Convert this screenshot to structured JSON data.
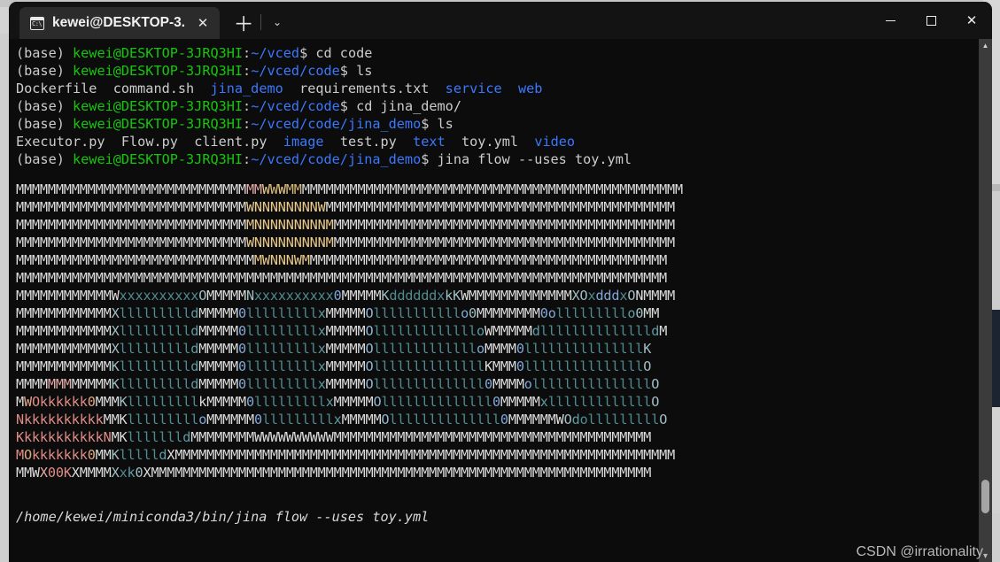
{
  "window": {
    "tab": {
      "icon": "console-icon",
      "title": "kewei@DESKTOP-3.",
      "close_label": "✕"
    },
    "newtab_label": "＋",
    "tabmenu_label": "⌄",
    "controls": {
      "minimize_label": "–",
      "maximize_label": "□",
      "close_label": "✕"
    }
  },
  "colors": {
    "terminal_bg": "#0c0c0c",
    "titlebar_bg": "#131313",
    "tab_bg": "#2b2b2b",
    "prompt_green": "#16c60c",
    "path_blue": "#3b78ff",
    "dir_blue": "#3b78ff",
    "text_white": "#cccccc",
    "scrollbar_track": "#3b3b3b",
    "scrollbar_thumb": "#a6a6a6",
    "art_gold": "#e8c98a",
    "art_teal": "#4e8b92",
    "art_blue": "#7fa8d8",
    "art_salmon": "#e3a9a5"
  },
  "terminal": {
    "lines": [
      {
        "type": "prompt",
        "env": "(base) ",
        "user_host": "kewei@DESKTOP-3JRQ3HI",
        "colon": ":",
        "path": "~/vced",
        "dollar": "$ ",
        "command": "cd code"
      },
      {
        "type": "prompt",
        "env": "(base) ",
        "user_host": "kewei@DESKTOP-3JRQ3HI",
        "colon": ":",
        "path": "~/vced/code",
        "dollar": "$ ",
        "command": "ls"
      },
      {
        "type": "ls",
        "entries": [
          {
            "name": "Dockerfile",
            "kind": "file"
          },
          {
            "name": "command.sh",
            "kind": "file"
          },
          {
            "name": "jina_demo",
            "kind": "dir"
          },
          {
            "name": "requirements.txt",
            "kind": "file"
          },
          {
            "name": "service",
            "kind": "dir"
          },
          {
            "name": "web",
            "kind": "dir"
          }
        ]
      },
      {
        "type": "prompt",
        "env": "(base) ",
        "user_host": "kewei@DESKTOP-3JRQ3HI",
        "colon": ":",
        "path": "~/vced/code",
        "dollar": "$ ",
        "command": "cd jina_demo/"
      },
      {
        "type": "prompt",
        "env": "(base) ",
        "user_host": "kewei@DESKTOP-3JRQ3HI",
        "colon": ":",
        "path": "~/vced/code/jina_demo",
        "dollar": "$ ",
        "command": "ls"
      },
      {
        "type": "ls",
        "entries": [
          {
            "name": "Executor.py",
            "kind": "file"
          },
          {
            "name": "Flow.py",
            "kind": "file"
          },
          {
            "name": "client.py",
            "kind": "file"
          },
          {
            "name": "image",
            "kind": "dir"
          },
          {
            "name": "test.py",
            "kind": "file"
          },
          {
            "name": "text",
            "kind": "dir"
          },
          {
            "name": "toy.yml",
            "kind": "file"
          },
          {
            "name": "video",
            "kind": "dir"
          }
        ]
      },
      {
        "type": "prompt",
        "env": "(base) ",
        "user_host": "kewei@DESKTOP-3JRQ3HI",
        "colon": ":",
        "path": "~/vced/code/jina_demo",
        "dollar": "$ ",
        "command": "jina flow --uses toy.yml"
      }
    ],
    "ascii_art": [
      [
        {
          "t": "MMMMMMMMMMMMMMMMMMMMMMMMMMMMM",
          "c": "a-w"
        },
        {
          "t": "MM",
          "c": "a-pk"
        },
        {
          "t": "W",
          "c": "a-gd"
        },
        {
          "t": "W",
          "c": "a-gd2"
        },
        {
          "t": "W",
          "c": "a-gd"
        },
        {
          "t": "MM",
          "c": "a-gd2"
        },
        {
          "t": "MMMMMMMMMMMMMMMMMMMMMMMMMMMMMMMMMMMMMMMMMMMMMMMM",
          "c": "a-w"
        }
      ],
      [
        {
          "t": "MMMMMMMMMMMMMMMMMMMMMMMMMMMMM",
          "c": "a-w"
        },
        {
          "t": "WNNNNNNNNW",
          "c": "a-gd"
        },
        {
          "t": "MMMMMMMMMMMMMMMMMMMMMMMMMMMMMMMMMMMMMMMMMMMM",
          "c": "a-w"
        }
      ],
      [
        {
          "t": "MMMMMMMMMMMMMMMMMMMMMMMMMMMMM",
          "c": "a-w"
        },
        {
          "t": "MNNNNNNNNNM",
          "c": "a-gd"
        },
        {
          "t": "MMMMMMMMMMMMMMMMMMMMMMMMMMMMMMMMMMMMMMMMMMM",
          "c": "a-w"
        }
      ],
      [
        {
          "t": "MMMMMMMMMMMMMMMMMMMMMMMMMMMMM",
          "c": "a-w"
        },
        {
          "t": "WNNNNNNNNNM",
          "c": "a-gd"
        },
        {
          "t": "MMMMMMMMMMMMMMMMMMMMMMMMMMMMMMMMMMMMMMMMMMM",
          "c": "a-w"
        }
      ],
      [
        {
          "t": "MMMMMMMMMMMMMMMMMMMMMMMMMMMMMM",
          "c": "a-w"
        },
        {
          "t": "MWNNNWM",
          "c": "a-gd"
        },
        {
          "t": "MMMMMMMMMMMMMMMMMMMMMMMMMMMMMMMMMMMMMMMMMMMMM",
          "c": "a-w"
        }
      ],
      [
        {
          "t": "MMMMMMMMMMMMMMMMMMMMMMMMMMMMMMMMMMMMMMMMMMMMMMMMMMMMMMMMMMMMMMMMMMMMMMMMMMMMMMMMMM",
          "c": "a-w"
        }
      ],
      [
        {
          "t": "MMMMMMMMMMMM",
          "c": "a-w"
        },
        {
          "t": "W",
          "c": "a-w"
        },
        {
          "t": "xxxxxxxxxx",
          "c": "a-tl"
        },
        {
          "t": "O",
          "c": "a-dk"
        },
        {
          "t": "MMMMM",
          "c": "a-w"
        },
        {
          "t": "N",
          "c": "a-dk"
        },
        {
          "t": "xxxxxxxxxx",
          "c": "a-tl"
        },
        {
          "t": "0",
          "c": "a-bl"
        },
        {
          "t": "MMMMM",
          "c": "a-w"
        },
        {
          "t": "K",
          "c": "a-dk"
        },
        {
          "t": "dddddd",
          "c": "a-tl"
        },
        {
          "t": "x",
          "c": "a-tl"
        },
        {
          "t": "k",
          "c": "a-dk"
        },
        {
          "t": "K",
          "c": "a-dk"
        },
        {
          "t": "WMMMMMMMMMMMMM",
          "c": "a-w"
        },
        {
          "t": "X",
          "c": "a-dk"
        },
        {
          "t": "O",
          "c": "a-dk"
        },
        {
          "t": "x",
          "c": "a-tl"
        },
        {
          "t": "ddd",
          "c": "a-bl"
        },
        {
          "t": "x",
          "c": "a-tl"
        },
        {
          "t": "O",
          "c": "a-dk"
        },
        {
          "t": "N",
          "c": "a-w"
        },
        {
          "t": "MMMM",
          "c": "a-w"
        }
      ],
      [
        {
          "t": "MMMMMMMMMMMM",
          "c": "a-w"
        },
        {
          "t": "X",
          "c": "a-dk"
        },
        {
          "t": "lllllllll",
          "c": "a-tl"
        },
        {
          "t": "d",
          "c": "a-tl2"
        },
        {
          "t": "MMMMM",
          "c": "a-w"
        },
        {
          "t": "0",
          "c": "a-bl"
        },
        {
          "t": "lllllllll",
          "c": "a-tl"
        },
        {
          "t": "x",
          "c": "a-tl2"
        },
        {
          "t": "MMMMM",
          "c": "a-w"
        },
        {
          "t": "O",
          "c": "a-sl"
        },
        {
          "t": "lllllllllll",
          "c": "a-tl"
        },
        {
          "t": "o",
          "c": "a-bl"
        },
        {
          "t": "0",
          "c": "a-dk"
        },
        {
          "t": "MMMMMMMM",
          "c": "a-w"
        },
        {
          "t": "0",
          "c": "a-bl"
        },
        {
          "t": "o",
          "c": "a-bl"
        },
        {
          "t": "lllllllll",
          "c": "a-tl"
        },
        {
          "t": "o",
          "c": "a-tl2"
        },
        {
          "t": "0",
          "c": "a-dk"
        },
        {
          "t": "MM",
          "c": "a-w"
        }
      ],
      [
        {
          "t": "MMMMMMMMMMMM",
          "c": "a-w"
        },
        {
          "t": "X",
          "c": "a-dk"
        },
        {
          "t": "lllllllll",
          "c": "a-tl"
        },
        {
          "t": "d",
          "c": "a-tl2"
        },
        {
          "t": "MMMMM",
          "c": "a-w"
        },
        {
          "t": "0",
          "c": "a-bl"
        },
        {
          "t": "lllllllll",
          "c": "a-tl"
        },
        {
          "t": "x",
          "c": "a-tl2"
        },
        {
          "t": "MMMMM",
          "c": "a-w"
        },
        {
          "t": "O",
          "c": "a-sl"
        },
        {
          "t": "lllllllllllll",
          "c": "a-tl"
        },
        {
          "t": "o",
          "c": "a-tl2"
        },
        {
          "t": "W",
          "c": "a-w"
        },
        {
          "t": "MMMMM",
          "c": "a-w"
        },
        {
          "t": "d",
          "c": "a-tl2"
        },
        {
          "t": "llllllllllllll",
          "c": "a-tl"
        },
        {
          "t": "d",
          "c": "a-tl2"
        },
        {
          "t": "M",
          "c": "a-w"
        }
      ],
      [
        {
          "t": "MMMMMMMMMMMM",
          "c": "a-w"
        },
        {
          "t": "X",
          "c": "a-dk"
        },
        {
          "t": "lllllllll",
          "c": "a-tl"
        },
        {
          "t": "d",
          "c": "a-tl2"
        },
        {
          "t": "MMMMM",
          "c": "a-w"
        },
        {
          "t": "0",
          "c": "a-bl"
        },
        {
          "t": "lllllllll",
          "c": "a-tl"
        },
        {
          "t": "x",
          "c": "a-tl2"
        },
        {
          "t": "MMMMM",
          "c": "a-w"
        },
        {
          "t": "O",
          "c": "a-sl"
        },
        {
          "t": "lllllllllllll",
          "c": "a-tl"
        },
        {
          "t": "o",
          "c": "a-bl"
        },
        {
          "t": "MMMM",
          "c": "a-w"
        },
        {
          "t": "0",
          "c": "a-bl"
        },
        {
          "t": "lllllllllllllll",
          "c": "a-tl"
        },
        {
          "t": "K",
          "c": "a-dk"
        }
      ],
      [
        {
          "t": "MMMMMMMMMMMM",
          "c": "a-w"
        },
        {
          "t": "K",
          "c": "a-dk"
        },
        {
          "t": "lllllllll",
          "c": "a-tl"
        },
        {
          "t": "d",
          "c": "a-tl2"
        },
        {
          "t": "MMMMM",
          "c": "a-w"
        },
        {
          "t": "0",
          "c": "a-bl"
        },
        {
          "t": "lllllllll",
          "c": "a-tl"
        },
        {
          "t": "x",
          "c": "a-tl2"
        },
        {
          "t": "MMMMM",
          "c": "a-w"
        },
        {
          "t": "O",
          "c": "a-sl"
        },
        {
          "t": "llllllllllllll",
          "c": "a-tl"
        },
        {
          "t": "K",
          "c": "a-w"
        },
        {
          "t": "MMM",
          "c": "a-w"
        },
        {
          "t": "0",
          "c": "a-bl"
        },
        {
          "t": "lllllllllllllll",
          "c": "a-tl"
        },
        {
          "t": "O",
          "c": "a-dk"
        }
      ],
      [
        {
          "t": "MMMM",
          "c": "a-w"
        },
        {
          "t": "MMM",
          "c": "a-pk"
        },
        {
          "t": "MMMMM",
          "c": "a-w"
        },
        {
          "t": "K",
          "c": "a-dk"
        },
        {
          "t": "lllllllll",
          "c": "a-tl"
        },
        {
          "t": "d",
          "c": "a-tl2"
        },
        {
          "t": "MMMMM",
          "c": "a-w"
        },
        {
          "t": "0",
          "c": "a-bl"
        },
        {
          "t": "lllllllll",
          "c": "a-tl"
        },
        {
          "t": "x",
          "c": "a-tl2"
        },
        {
          "t": "MMMMM",
          "c": "a-w"
        },
        {
          "t": "O",
          "c": "a-sl"
        },
        {
          "t": "llllllllllllll",
          "c": "a-tl"
        },
        {
          "t": "0",
          "c": "a-bl"
        },
        {
          "t": "MMMM",
          "c": "a-w"
        },
        {
          "t": "o",
          "c": "a-bl"
        },
        {
          "t": "lllllllllllllll",
          "c": "a-tl"
        },
        {
          "t": "O",
          "c": "a-dk"
        }
      ],
      [
        {
          "t": "M",
          "c": "a-w"
        },
        {
          "t": "W",
          "c": "a-or"
        },
        {
          "t": "O",
          "c": "a-rd"
        },
        {
          "t": "kkkkkk",
          "c": "a-rd"
        },
        {
          "t": "0",
          "c": "a-or"
        },
        {
          "t": "MMM",
          "c": "a-w"
        },
        {
          "t": "K",
          "c": "a-dk"
        },
        {
          "t": "lllllllll",
          "c": "a-tl"
        },
        {
          "t": "k",
          "c": "a-w"
        },
        {
          "t": "MMMMM",
          "c": "a-w"
        },
        {
          "t": "0",
          "c": "a-bl"
        },
        {
          "t": "lllllllll",
          "c": "a-tl"
        },
        {
          "t": "x",
          "c": "a-tl2"
        },
        {
          "t": "MMMMM",
          "c": "a-w"
        },
        {
          "t": "O",
          "c": "a-sl"
        },
        {
          "t": "llllllllllllll",
          "c": "a-tl"
        },
        {
          "t": "0",
          "c": "a-bl"
        },
        {
          "t": "MMMMM",
          "c": "a-w"
        },
        {
          "t": "x",
          "c": "a-tl2"
        },
        {
          "t": "lllllllllllll",
          "c": "a-tl"
        },
        {
          "t": "O",
          "c": "a-dk"
        }
      ],
      [
        {
          "t": "N",
          "c": "a-rd"
        },
        {
          "t": "kkkkkkkkkk",
          "c": "a-rd"
        },
        {
          "t": "MMK",
          "c": "a-w"
        },
        {
          "t": "lllllllll",
          "c": "a-tl"
        },
        {
          "t": "o",
          "c": "a-bl"
        },
        {
          "t": "MMMMMM",
          "c": "a-w"
        },
        {
          "t": "0",
          "c": "a-bl"
        },
        {
          "t": "lllllllll",
          "c": "a-tl"
        },
        {
          "t": "x",
          "c": "a-tl2"
        },
        {
          "t": "MMMMM",
          "c": "a-w"
        },
        {
          "t": "O",
          "c": "a-sl"
        },
        {
          "t": "llllllllllllll",
          "c": "a-tl"
        },
        {
          "t": "0",
          "c": "a-bl"
        },
        {
          "t": "MMMMMM",
          "c": "a-w"
        },
        {
          "t": "W",
          "c": "a-w"
        },
        {
          "t": "O",
          "c": "a-dk"
        },
        {
          "t": "d",
          "c": "a-tl2"
        },
        {
          "t": "olllllllll",
          "c": "a-tl"
        },
        {
          "t": "O",
          "c": "a-dk"
        }
      ],
      [
        {
          "t": "K",
          "c": "a-rd"
        },
        {
          "t": "kkkkkkkkkk",
          "c": "a-rd"
        },
        {
          "t": "N",
          "c": "a-rd"
        },
        {
          "t": "MK",
          "c": "a-w"
        },
        {
          "t": "lllllll",
          "c": "a-tl"
        },
        {
          "t": "d",
          "c": "a-tl2"
        },
        {
          "t": "MMMMMMMM",
          "c": "a-w"
        },
        {
          "t": "WWWWWWWWWW",
          "c": "a-w"
        },
        {
          "t": "MMMMMMMMMMMMMMMMMMMMMMMMMMMMMMMMMMMMMMMM",
          "c": "a-w"
        }
      ],
      [
        {
          "t": "M",
          "c": "a-rd"
        },
        {
          "t": "O",
          "c": "a-or"
        },
        {
          "t": "kkkkkkk",
          "c": "a-rd"
        },
        {
          "t": "0",
          "c": "a-or"
        },
        {
          "t": "MM",
          "c": "a-w"
        },
        {
          "t": "K",
          "c": "a-dk"
        },
        {
          "t": "lllll",
          "c": "a-tl"
        },
        {
          "t": "d",
          "c": "a-tl2"
        },
        {
          "t": "XMMMMMMMMMMMMMMMMMMMMMMMMMMMMMMMMMMMMMMMMMMMMMMMMMMMMMMMMMMMMMMM",
          "c": "a-w"
        }
      ],
      [
        {
          "t": "MMW",
          "c": "a-w"
        },
        {
          "t": "X",
          "c": "a-pk"
        },
        {
          "t": "0",
          "c": "a-rd"
        },
        {
          "t": "0",
          "c": "a-rd"
        },
        {
          "t": "K",
          "c": "a-rd"
        },
        {
          "t": "XMMMM",
          "c": "a-w"
        },
        {
          "t": "X",
          "c": "a-dk"
        },
        {
          "t": "x",
          "c": "a-tl"
        },
        {
          "t": "k",
          "c": "a-tl2"
        },
        {
          "t": "0",
          "c": "a-dk"
        },
        {
          "t": "XMMMMMMMMMMMMMMMMMMMMMMMMMMMMMMMMMMMMMMMMMMMMMMMMMMMMMMMMMMMMMMM",
          "c": "a-w"
        }
      ]
    ],
    "status_line": "/home/kewei/miniconda3/bin/jina flow --uses toy.yml"
  },
  "scrollbar": {
    "up_arrow": "▲"
  },
  "watermark": {
    "text": "CSDN @irrationality"
  }
}
